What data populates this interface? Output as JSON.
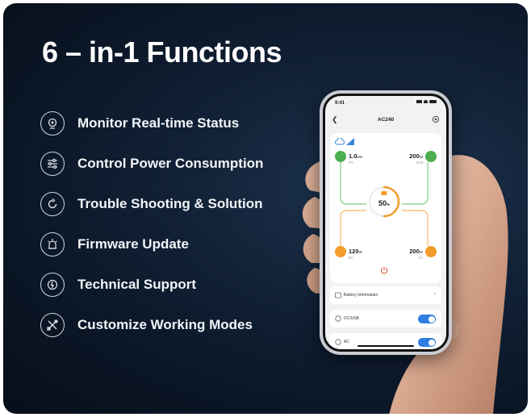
{
  "title": "6 – in-1 Functions",
  "features": [
    {
      "label": "Monitor Real-time Status",
      "icon": "monitor-icon"
    },
    {
      "label": "Control Power Consumption",
      "icon": "sliders-icon"
    },
    {
      "label": "Trouble Shooting & Solution",
      "icon": "refresh-icon"
    },
    {
      "label": "Firmware Update",
      "icon": "firmware-icon"
    },
    {
      "label": "Technical Support",
      "icon": "support-icon"
    },
    {
      "label": "Customize Working Modes",
      "icon": "tools-icon"
    }
  ],
  "phone": {
    "time": "9:41",
    "device_name": "AC240",
    "pv": {
      "value": "1.0",
      "unit": "kW",
      "label": "PV"
    },
    "grid": {
      "value": "200",
      "unit": "W",
      "label": "Grid"
    },
    "dc": {
      "value": "120",
      "unit": "W",
      "label": "DC"
    },
    "ac": {
      "value": "200",
      "unit": "W",
      "label": "AC"
    },
    "battery": {
      "percent": "50",
      "unit": "%"
    },
    "battery_info_label": "Battery Information",
    "dc_usb_label": "DC/USB",
    "ac_label": "AC",
    "dc_usb_on": true,
    "ac_on": true
  },
  "colors": {
    "green": "#4caf50",
    "orange": "#f39c2d",
    "toggle_blue": "#2f7de1",
    "power_red": "#e25b4b"
  }
}
